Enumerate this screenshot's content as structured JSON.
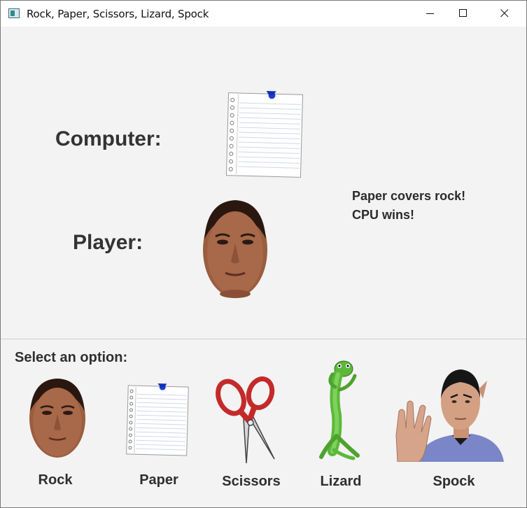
{
  "window": {
    "title": "Rock, Paper, Scissors, Lizard, Spock",
    "icons": [
      "app-icon",
      "minimize-icon",
      "maximize-icon",
      "close-icon"
    ]
  },
  "game": {
    "computer_label": "Computer:",
    "player_label": "Player:",
    "computer_choice": "paper",
    "player_choice": "rock",
    "result_line1": "Paper covers rock!",
    "result_line2": "CPU wins!"
  },
  "options": {
    "prompt": "Select an option:",
    "items": [
      {
        "label": "Rock",
        "image": "rock-face"
      },
      {
        "label": "Paper",
        "image": "notepad-paper"
      },
      {
        "label": "Scissors",
        "image": "scissors"
      },
      {
        "label": "Lizard",
        "image": "gecko-lizard"
      },
      {
        "label": "Spock",
        "image": "spock"
      }
    ]
  }
}
